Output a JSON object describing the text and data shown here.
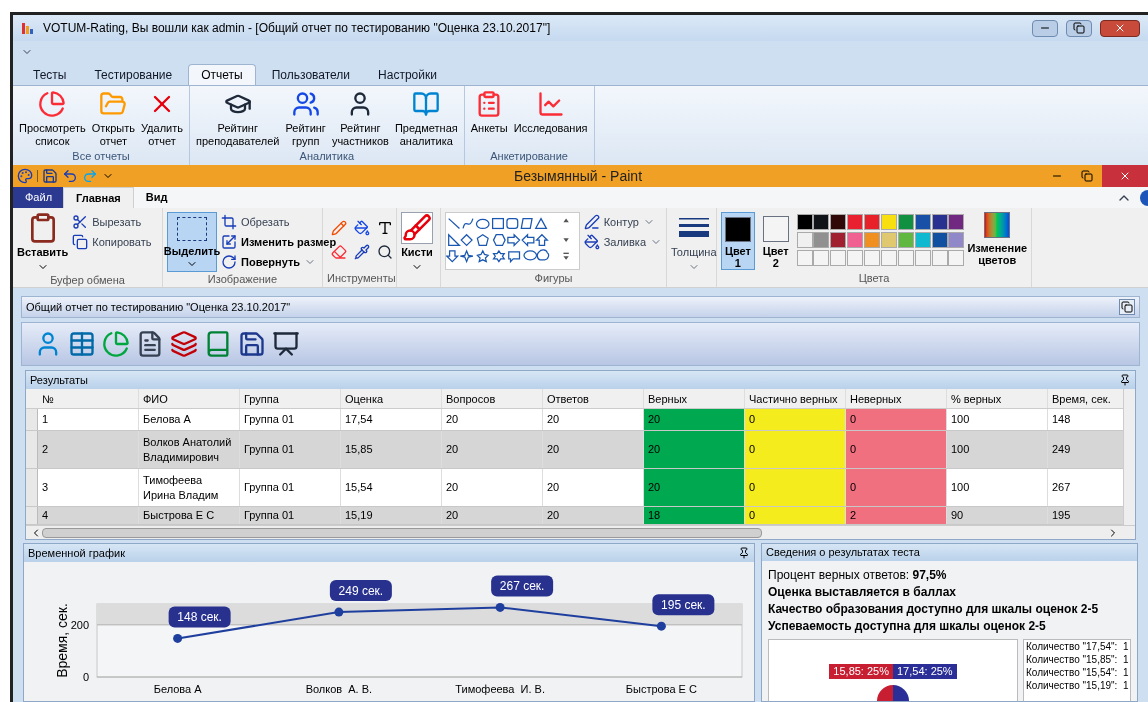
{
  "window": {
    "title": "VOTUM-Rating, Вы вошли как admin - [Общий отчет по тестированию \"Оценка 23.10.2017\"]"
  },
  "ribbon": {
    "tabs": [
      {
        "label": "Тесты",
        "selected": false
      },
      {
        "label": "Тестирование",
        "selected": false
      },
      {
        "label": "Отчеты",
        "selected": true
      },
      {
        "label": "Пользователи",
        "selected": false
      },
      {
        "label": "Настройки",
        "selected": false
      }
    ],
    "groups": [
      {
        "label": "Все отчеты",
        "buttons": [
          "Просмотреть\nсписок",
          "Открыть\nотчет",
          "Удалить\nотчет"
        ]
      },
      {
        "label": "Аналитика",
        "buttons": [
          "Рейтинг\nпреподавателей",
          "Рейтинг\nгрупп",
          "Рейтинг\nучастников",
          "Предметная\nаналитика"
        ]
      },
      {
        "label": "Анкетирование",
        "buttons": [
          "Анкеты",
          "Исследования"
        ]
      }
    ]
  },
  "paint": {
    "title": "Безымянный - Paint",
    "tabs": [
      {
        "label": "Файл",
        "kind": "menu",
        "selected": false
      },
      {
        "label": "Главная",
        "kind": "tab",
        "selected": true
      },
      {
        "label": "Вид",
        "kind": "tab",
        "selected": false
      }
    ],
    "clipboard": {
      "label": "Буфер обмена",
      "paste": "Вставить",
      "cut": "Вырезать",
      "copy": "Копировать"
    },
    "image": {
      "label": "Изображение",
      "select": {
        "label": "Выделить",
        "selected": true
      },
      "crop": "Обрезать",
      "resize": "Изменить размер",
      "rotate": "Повернуть"
    },
    "tools": {
      "label": "Инструменты"
    },
    "brushes": {
      "label": "Кисти"
    },
    "shapes": {
      "label": "Фигуры",
      "outline": "Контур",
      "fill": "Заливка"
    },
    "size": {
      "label": "Толщина"
    },
    "colors": {
      "label": "Цвета",
      "edit": "Изменение\nцветов",
      "slots": [
        {
          "label": "Цвет\n1",
          "color": "#000000",
          "selected": true
        },
        {
          "label": "Цвет\n2",
          "color": "#f4f4f4",
          "selected": false
        }
      ],
      "palette": [
        {
          "color": "#000000"
        },
        {
          "color": "#101418"
        },
        {
          "color": "#300808"
        },
        {
          "color": "#e82030"
        },
        {
          "color": "#e8202a"
        },
        {
          "color": "#f8e010"
        },
        {
          "color": "#109040"
        },
        {
          "color": "#1850a8"
        },
        {
          "color": "#283090"
        },
        {
          "color": "#702880"
        },
        {
          "color": "#f0f0f0"
        },
        {
          "color": "#909090"
        },
        {
          "color": "#a02030"
        },
        {
          "color": "#f06090"
        },
        {
          "color": "#f09020"
        },
        {
          "color": "#e0c870"
        },
        {
          "color": "#60b840"
        },
        {
          "color": "#10b8d0"
        },
        {
          "color": "#1050a0"
        },
        {
          "color": "#9088c8"
        }
      ]
    }
  },
  "report": {
    "title": "Общий отчет по тестированию \"Оценка 23.10.2017\"",
    "results": {
      "title": "Результаты",
      "columns": [
        {
          "label": "№"
        },
        {
          "label": "ФИО"
        },
        {
          "label": "Группа"
        },
        {
          "label": "Оценка"
        },
        {
          "label": "Вопросов"
        },
        {
          "label": "Ответов"
        },
        {
          "label": "Верных",
          "color": "#00a84f"
        },
        {
          "label": "Частично верных",
          "color": "#f4ec1c"
        },
        {
          "label": "Неверных",
          "color": "#f07080"
        },
        {
          "label": "% верных"
        },
        {
          "label": "Время, сек."
        }
      ],
      "rows": [
        {
          "cells": [
            "1",
            "Белова А",
            "Группа 01",
            "17,54",
            "20",
            "20",
            "20",
            "0",
            "0",
            "100",
            "148"
          ]
        },
        {
          "cells": [
            "2",
            "Волков Анатолий Владимирович",
            "Группа 01",
            "15,85",
            "20",
            "20",
            "20",
            "0",
            "0",
            "100",
            "249"
          ]
        },
        {
          "cells": [
            "3",
            "Тимофеева Ирина Владим",
            "Группа 01",
            "15,54",
            "20",
            "20",
            "20",
            "0",
            "0",
            "100",
            "267"
          ]
        },
        {
          "cells": [
            "4",
            "Быстрова Е С",
            "Группа 01",
            "15,19",
            "20",
            "20",
            "18",
            "0",
            "2",
            "90",
            "195"
          ]
        }
      ]
    },
    "timeline": {
      "title": "Временной график",
      "chart_data": {
        "type": "line",
        "ylabel": "Время, сек.",
        "categories": [
          "Белова А",
          "Волков  А. В.",
          "Тимофеева  И. В.",
          "Быстрова Е С"
        ],
        "series": [
          {
            "color": "#1f3f9e",
            "marker": "circle",
            "values": [
              148,
              249,
              267,
              195
            ]
          }
        ],
        "ylim": [
          0,
          280
        ],
        "yticks": [
          0,
          200
        ],
        "value_labels": [
          "148 сек.",
          "249 сек.",
          "267 сек.",
          "195 сек."
        ]
      }
    },
    "summary": {
      "title": "Сведения о результатах теста",
      "lines": [
        {
          "text": "Процент верных ответов: **97,5%**",
          "bold": false
        },
        {
          "text": "Оценка выставляется в баллах",
          "bold": true
        },
        {
          "text": "Качество образования доступно для шкалы оценок 2-5",
          "bold": true
        },
        {
          "text": "Успеваемость доступна для шкалы оценок 2-5",
          "bold": true
        }
      ],
      "pie_labels": [
        {
          "text": "15,85: 25%",
          "color": "#c81e32"
        },
        {
          "text": "17,54: 25%",
          "color": "#2a2e96"
        }
      ],
      "legend": [
        "Количество \"17,54\":  1",
        "Количество \"15,85\":  1",
        "Количество \"15,54\":  1",
        "Количество \"15,19\":  1"
      ]
    }
  }
}
